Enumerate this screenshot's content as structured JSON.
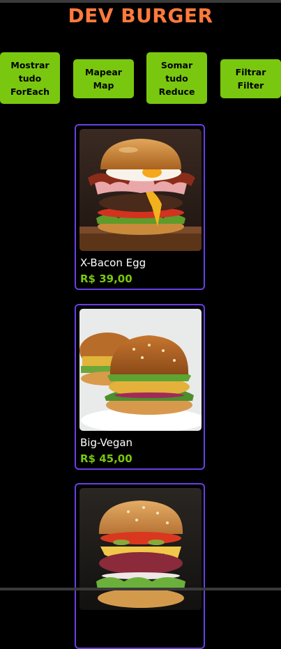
{
  "colors": {
    "title": "#ff7a3c",
    "button_bg": "#7ac70f",
    "price": "#7ac70f",
    "card_border": "#6a3ee6",
    "background": "#000000"
  },
  "header": {
    "title": "DEV BURGER"
  },
  "actions": [
    {
      "lines": [
        "Mostrar",
        "tudo",
        "ForEach"
      ]
    },
    {
      "lines": [
        "Mapear",
        "Map"
      ]
    },
    {
      "lines": [
        "Somar",
        "tudo",
        "Reduce"
      ]
    },
    {
      "lines": [
        "Filtrar",
        "Filter"
      ]
    }
  ],
  "products": [
    {
      "name": "X-Bacon Egg",
      "price": "R$ 39,00",
      "image": "bacon-egg-burger-photo"
    },
    {
      "name": "Big-Vegan",
      "price": "R$ 45,00",
      "image": "vegan-burger-photo"
    },
    {
      "name": "",
      "price": "",
      "image": "beet-burger-photo"
    }
  ]
}
